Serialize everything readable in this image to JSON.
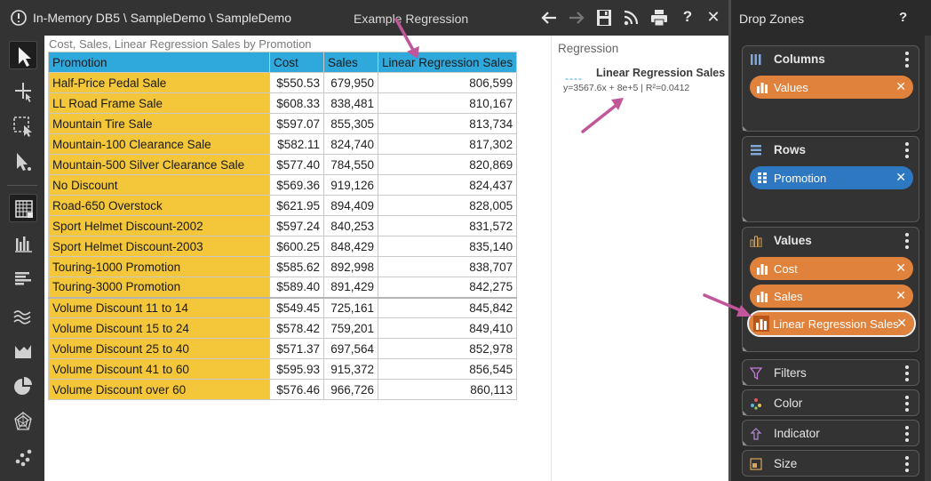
{
  "titlebar": {
    "breadcrumb": "In-Memory DB5 \\ SampleDemo \\ SampleDemo",
    "view_title": "Example Regression",
    "icons": [
      "back-icon",
      "forward-icon",
      "save-icon",
      "rss-icon",
      "print-icon",
      "help-icon",
      "close-icon"
    ],
    "help_label": "?",
    "close_label": "✕"
  },
  "left_toolbar": {
    "tools": [
      "select-icon",
      "move-icon",
      "marquee-select-icon",
      "drill-icon",
      "table-icon",
      "column-chart-icon",
      "bar-chart-icon",
      "line-chart-icon",
      "area-chart-icon",
      "pie-chart-icon",
      "radar-chart-icon",
      "scatter-chart-icon"
    ],
    "active_tool": "table-icon"
  },
  "table": {
    "caption": "Cost, Sales, Linear Regression Sales by Promotion",
    "columns": [
      "Promotion",
      "Cost",
      "Sales",
      "Linear Regression Sales"
    ],
    "rows": [
      [
        "Half-Price Pedal Sale",
        "$550.53",
        "679,950",
        "806,599"
      ],
      [
        "LL Road Frame Sale",
        "$608.33",
        "838,481",
        "810,167"
      ],
      [
        "Mountain Tire Sale",
        "$597.07",
        "855,305",
        "813,734"
      ],
      [
        "Mountain-100 Clearance Sale",
        "$582.11",
        "824,740",
        "817,302"
      ],
      [
        "Mountain-500 Silver Clearance Sale",
        "$577.40",
        "784,550",
        "820,869"
      ],
      [
        "No Discount",
        "$569.36",
        "919,126",
        "824,437"
      ],
      [
        "Road-650 Overstock",
        "$621.95",
        "894,409",
        "828,005"
      ],
      [
        "Sport Helmet Discount-2002",
        "$597.24",
        "840,253",
        "831,572"
      ],
      [
        "Sport Helmet Discount-2003",
        "$600.25",
        "848,429",
        "835,140"
      ],
      [
        "Touring-1000 Promotion",
        "$585.62",
        "892,998",
        "838,707"
      ],
      [
        "Touring-3000 Promotion",
        "$589.40",
        "891,429",
        "842,275"
      ],
      [
        "Volume Discount 11 to 14",
        "$549.45",
        "725,161",
        "845,842"
      ],
      [
        "Volume Discount 15 to 24",
        "$578.42",
        "759,201",
        "849,410"
      ],
      [
        "Volume Discount 25 to 40",
        "$571.37",
        "697,564",
        "852,978"
      ],
      [
        "Volume Discount 41 to 60",
        "$595.93",
        "915,372",
        "856,545"
      ],
      [
        "Volume Discount over 60",
        "$576.46",
        "966,726",
        "860,113"
      ]
    ]
  },
  "legend": {
    "title": "Regression",
    "dash": "----",
    "series": "Linear Regression Sales",
    "equation": "y=3567.6x + 8e+5 | R²=0.0412"
  },
  "dropzones": {
    "title": "Drop Zones",
    "help": "?",
    "columns": {
      "label": "Columns",
      "pills": [
        "Values"
      ]
    },
    "rows": {
      "label": "Rows",
      "pills": [
        "Promotion"
      ]
    },
    "values": {
      "label": "Values",
      "pills": [
        "Cost",
        "Sales",
        "Linear Regression Sales"
      ]
    },
    "filters": {
      "label": "Filters"
    },
    "color": {
      "label": "Color"
    },
    "indicator": {
      "label": "Indicator"
    },
    "size": {
      "label": "Size"
    },
    "remove_label": "✕"
  },
  "colors": {
    "header_blue": "#2fa8dc",
    "rowhead_yellow": "#f4c63a",
    "pill_orange": "#e0823c",
    "pill_blue": "#2e78c2",
    "annotation_arrow": "#c2569a"
  }
}
